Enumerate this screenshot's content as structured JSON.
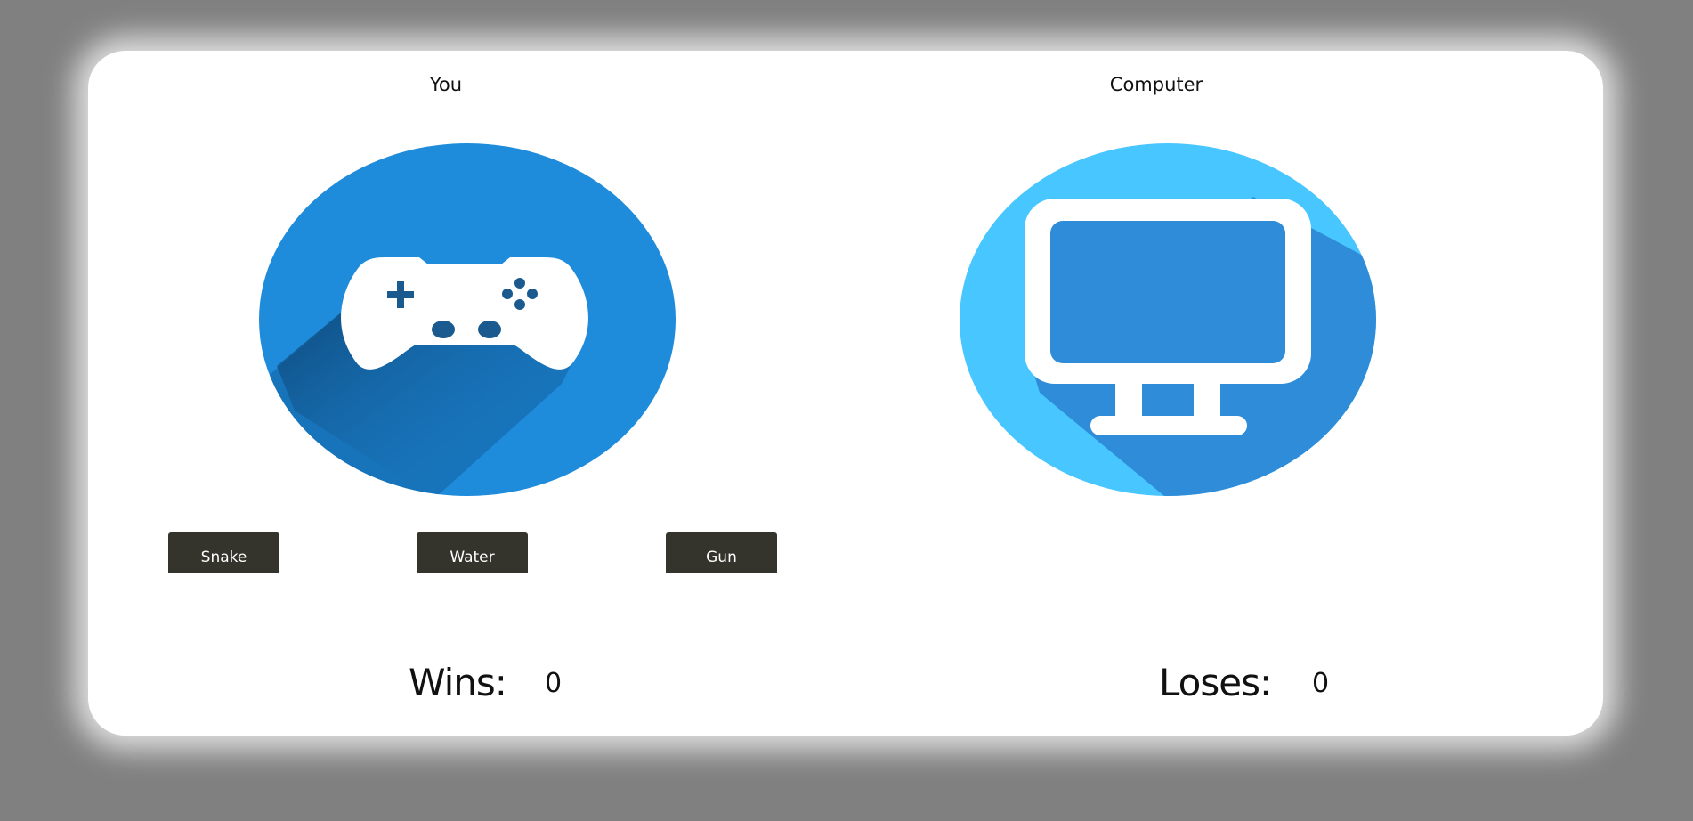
{
  "player": {
    "title": "You",
    "avatar_icon": "gamepad-icon",
    "avatar_bg": "#1e8bdb",
    "choices": [
      "Snake",
      "Water",
      "Gun"
    ]
  },
  "computer": {
    "title": "Computer",
    "avatar_icon": "monitor-icon",
    "avatar_bg": "#48c6ff"
  },
  "scores": {
    "wins_label": "Wins:",
    "wins_value": "0",
    "loses_label": "Loses:",
    "loses_value": "0"
  },
  "colors": {
    "button_bg": "#34342c",
    "page_bg": "#808080"
  }
}
